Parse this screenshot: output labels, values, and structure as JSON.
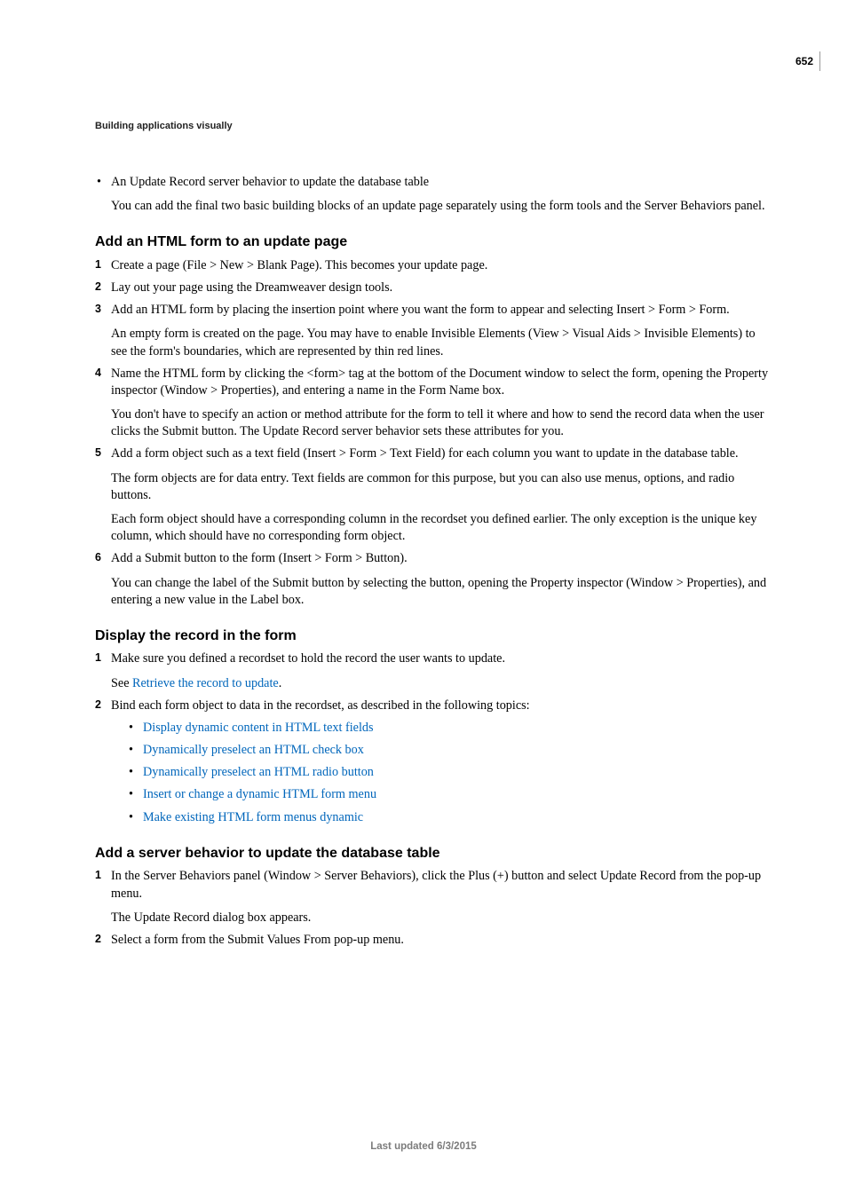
{
  "page_number": "652",
  "running_head": "Building applications visually",
  "intro": {
    "bullet": "An Update Record server behavior to update the database table",
    "para": "You can add the final two basic building blocks of an update page separately using the form tools and the Server Behaviors panel."
  },
  "sections": {
    "s1": {
      "title": "Add an HTML form to an update page",
      "items": [
        "Create a page (File > New > Blank Page). This becomes your update page.",
        "Lay out your page using the Dreamweaver design tools.",
        "Add an HTML form by placing the insertion point where you want the form to appear and selecting Insert > Form > Form.",
        "Name the HTML form by clicking the <form> tag at the bottom of the Document window to select the form, opening the Property inspector (Window > Properties), and entering a name in the Form Name box.",
        "Add a form object such as a text field (Insert > Form > Text Field) for each column you want to update in the database table.",
        "Add a Submit button to the form (Insert > Form > Button)."
      ],
      "paras": {
        "after3": "An empty form is created on the page. You may have to enable Invisible Elements (View > Visual Aids > Invisible Elements) to see the form's boundaries, which are represented by thin red lines.",
        "after4": "You don't have to specify an action or method attribute for the form to tell it where and how to send the record data when the user clicks the Submit button. The Update Record server behavior sets these attributes for you.",
        "after5a": "The form objects are for data entry. Text fields are common for this purpose, but you can also use menus, options, and radio buttons.",
        "after5b": "Each form object should have a corresponding column in the recordset you defined earlier. The only exception is the unique key column, which should have no corresponding form object.",
        "after6": "You can change the label of the Submit button by selecting the button, opening the Property inspector (Window > Properties), and entering a new value in the Label box."
      }
    },
    "s2": {
      "title": "Display the record in the form",
      "items": [
        "Make sure you defined a recordset to hold the record the user wants to update.",
        "Bind each form object to data in the recordset, as described in the following topics:"
      ],
      "see_prefix": "See ",
      "see_link": "Retrieve the record to update",
      "see_suffix": ".",
      "sublinks": [
        "Display dynamic content in HTML text fields",
        "Dynamically preselect an HTML check box",
        "Dynamically preselect an HTML radio button",
        "Insert or change a dynamic HTML form menu",
        "Make existing HTML form menus dynamic"
      ]
    },
    "s3": {
      "title": "Add a server behavior to update the database table",
      "items": [
        "In the Server Behaviors panel (Window > Server Behaviors), click the Plus (+) button and select Update Record from the pop-up menu.",
        "Select a form from the Submit Values From pop-up menu."
      ],
      "after1": "The Update Record dialog box appears."
    }
  },
  "footer": "Last updated 6/3/2015"
}
